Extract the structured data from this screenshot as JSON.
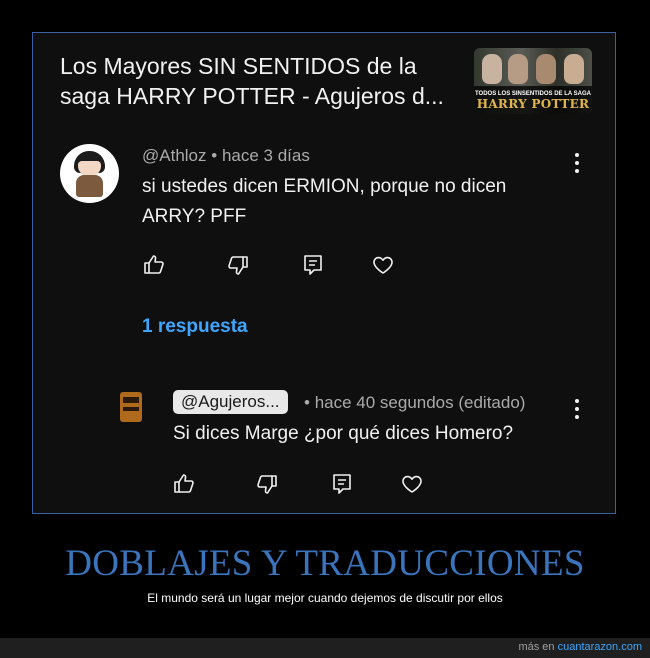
{
  "video": {
    "title": "Los Mayores SIN SENTIDOS de la saga HARRY POTTER - Agujeros d...",
    "thumbnail": {
      "caption_small": "TODOS LOS SINSENTIDOS DE LA SAGA",
      "caption_big": "HARRY POTTER"
    }
  },
  "comment": {
    "author": "@Athloz",
    "separator": "•",
    "time": "hace 3 días",
    "text": "si ustedes dicen ERMION, porque no dicen ARRY? PFF",
    "actions": [
      "thumb-up-icon",
      "thumb-down-icon",
      "reply-icon",
      "heart-icon"
    ],
    "replies_link": "1 respuesta"
  },
  "reply": {
    "author": "@Agujeros...",
    "separator": "•",
    "time": "hace 40 segundos (editado)",
    "text": "Si dices Marge ¿por qué dices Homero?",
    "actions": [
      "thumb-up-icon",
      "thumb-down-icon",
      "reply-icon",
      "heart-icon"
    ]
  },
  "footer": {
    "title": "DOBLAJES Y TRADUCCIONES",
    "subtitle": "El mundo será un lugar mejor cuando dejemos de discutir por ellos",
    "credit_prefix": "más en",
    "credit_link": "cuantarazon.com"
  },
  "colors": {
    "frame_border": "#3b5fa3",
    "background": "#0f0f0f",
    "link": "#3ea6ff",
    "footer_title": "#3a74bd"
  }
}
